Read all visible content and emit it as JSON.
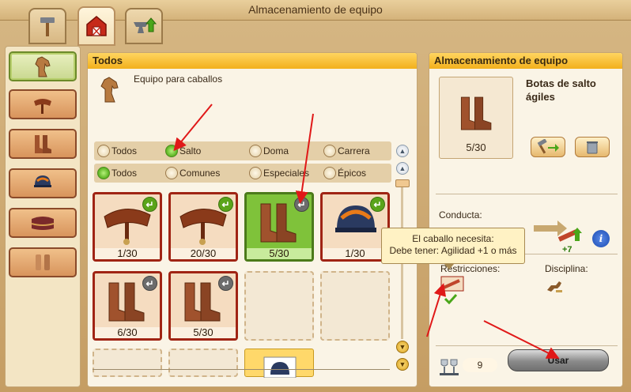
{
  "window": {
    "title": "Almacenamiento de equipo"
  },
  "tabs": [
    {
      "icon": "hammer-icon"
    },
    {
      "icon": "barn-icon",
      "active": true
    },
    {
      "icon": "anvil-upgrade-icon"
    }
  ],
  "rail": [
    {
      "icon": "horse-head-icon",
      "active": true
    },
    {
      "icon": "saddle-icon"
    },
    {
      "icon": "boots-icon"
    },
    {
      "icon": "helmet-icon"
    },
    {
      "icon": "saddle-pad-icon"
    },
    {
      "icon": "leg-wraps-icon"
    }
  ],
  "left_panel": {
    "title": "Todos",
    "subtitle": "Equipo para caballos",
    "filter_row1": [
      {
        "label": "Todos",
        "selected": false
      },
      {
        "label": "Salto",
        "selected": true
      },
      {
        "label": "Doma",
        "selected": false
      },
      {
        "label": "Carrera",
        "selected": false
      }
    ],
    "filter_row2": [
      {
        "label": "Todos",
        "selected": true
      },
      {
        "label": "Comunes",
        "selected": false
      },
      {
        "label": "Especiales",
        "selected": false
      },
      {
        "label": "Épicos",
        "selected": false
      }
    ],
    "items": [
      {
        "name": "saddle",
        "count": "1/30",
        "badge": "green"
      },
      {
        "name": "saddle",
        "count": "20/30",
        "badge": "green"
      },
      {
        "name": "boots",
        "count": "5/30",
        "badge": "grey",
        "selected": true
      },
      {
        "name": "helmet",
        "count": "1/30",
        "badge": "green"
      },
      {
        "name": "boots",
        "count": "6/30",
        "badge": "grey"
      },
      {
        "name": "boots",
        "count": "5/30",
        "badge": "grey"
      }
    ]
  },
  "right_panel": {
    "title": "Almacenamiento de equipo",
    "item_name": "Botas de salto ágiles",
    "item_count": "5/30",
    "conducta_label": "Conducta:",
    "conducta_bonus": "+7",
    "restricciones_label": "Restricciones:",
    "disciplina_label": "Disciplina:",
    "tooltip_line1": "El caballo necesita:",
    "tooltip_line2": "Debe tener: Agilidad +1 o más",
    "trophy_count": "9",
    "use_button": "Usar"
  },
  "colors": {
    "accent": "#f2b01c",
    "selected_slot": "#7fc23a",
    "slot_border": "#a02414",
    "arrow": "#e01818"
  }
}
